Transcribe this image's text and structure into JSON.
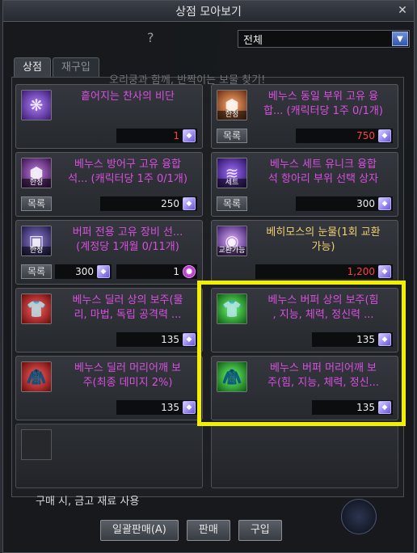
{
  "window": {
    "title": "상점 모아보기"
  },
  "filter": {
    "help": "?",
    "selected": "전체"
  },
  "tabs": [
    {
      "label": "상점"
    },
    {
      "label": "재구입"
    }
  ],
  "banner": "오리쿵과 함께, 반짝이는 보물 찾기!",
  "items": [
    {
      "name": "흩어지는 찬사의 비단",
      "price": "1",
      "price_color": "red",
      "icon_tag": "",
      "has_list": false
    },
    {
      "name": "베누스 동일 부위 고유 융\n합... (캐릭터당 1주 0/1개)",
      "price": "750",
      "price_color": "red",
      "icon_tag": "한정",
      "has_list": true,
      "list_label": "목록"
    },
    {
      "name": "베누스 방어구 고유 융합\n석... (캐릭터당 1주 0/1개)",
      "price": "250",
      "price_color": "white",
      "icon_tag": "한정",
      "has_list": true,
      "list_label": "목록"
    },
    {
      "name": "베누스 세트 유니크 융합\n석 항아리 부위 선택 상자",
      "price": "300",
      "price_color": "white",
      "icon_tag": "세트",
      "has_list": true,
      "list_label": "목록"
    },
    {
      "name": "버퍼 전용 고유 장비 선...\n(계정당 1개월 0/11개)",
      "price": "1",
      "price2": "300",
      "price_color": "white",
      "icon_tag": "한정",
      "has_list": true,
      "list_label": "목록"
    },
    {
      "name": "베히모스의 눈물(1회 교환\n가능)",
      "price": "1,200",
      "price_color": "red",
      "icon_tag": "교환가능",
      "has_list": false,
      "gold": true
    },
    {
      "name": "베누스 딜러 상의 보주(물\n리, 마법, 독립 공격력 ...",
      "price": "135",
      "price_color": "white",
      "icon_tag": "",
      "has_list": false
    },
    {
      "name": "베누스 버퍼 상의 보주(힘\n, 지능, 체력, 정신력 ...",
      "price": "135",
      "price_color": "white",
      "icon_tag": "",
      "has_list": false
    },
    {
      "name": "베누스 딜러 머리어깨 보\n주(최종 데미지 2%)",
      "price": "135",
      "price_color": "white",
      "icon_tag": "",
      "has_list": false
    },
    {
      "name": "베누스 버퍼 머리어깨 보\n주(힘, 지능, 체력, 정신...",
      "price": "135",
      "price_color": "white",
      "icon_tag": "",
      "has_list": false
    }
  ],
  "notice": "구매 시, 금고 재료 사용",
  "buttons": {
    "bulk_sell": "일괄판매(A)",
    "sell": "판매",
    "buy": "구입"
  },
  "colors": {
    "highlight": "#f2ef00",
    "item_name": "#d94fe0",
    "price_red": "#ff4040"
  }
}
